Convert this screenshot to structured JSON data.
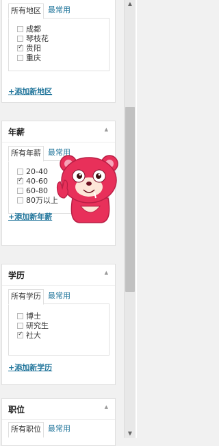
{
  "region_panel": {
    "tabs": {
      "all": "所有地区",
      "popular": "最常用"
    },
    "options": [
      {
        "label": "成都",
        "checked": false
      },
      {
        "label": "琴枝花",
        "checked": false
      },
      {
        "label": "贵阳",
        "checked": true
      },
      {
        "label": "重庆",
        "checked": false
      }
    ],
    "add_link": "+添加新地区"
  },
  "salary_panel": {
    "title": "年薪",
    "tabs": {
      "all": "所有年薪",
      "popular": "最常用"
    },
    "options": [
      {
        "label": "20-40",
        "checked": false
      },
      {
        "label": "40-60",
        "checked": true
      },
      {
        "label": "60-80",
        "checked": false
      },
      {
        "label": "80万以上",
        "checked": false
      }
    ],
    "add_link": "+添加新年薪"
  },
  "education_panel": {
    "title": "学历",
    "tabs": {
      "all": "所有学历",
      "popular": "最常用"
    },
    "options": [
      {
        "label": "博士",
        "checked": false
      },
      {
        "label": "研究生",
        "checked": false
      },
      {
        "label": "社大",
        "checked": true
      }
    ],
    "add_link": "+添加新学历"
  },
  "position_panel": {
    "title": "职位",
    "tabs": {
      "all": "所有职位",
      "popular": "最常用"
    }
  },
  "colors": {
    "link": "#21759b",
    "mascot": "#e8305a"
  },
  "icons": {
    "collapse": "triangle-up-icon",
    "mascot": "pink-bear-mascot"
  }
}
